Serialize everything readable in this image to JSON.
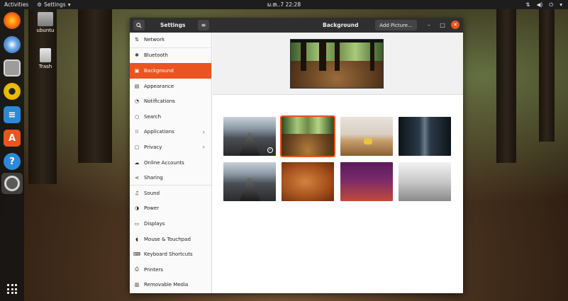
{
  "topbar": {
    "activities": "Activities",
    "app_menu": "Settings",
    "clock": "ພ.ຫ..7  22:28"
  },
  "desktop": {
    "home_label": "ubuntu",
    "trash_label": "Trash"
  },
  "dock": {
    "items": [
      "firefox",
      "thunderbird",
      "files",
      "rhythmbox",
      "writer",
      "software",
      "help",
      "settings"
    ]
  },
  "window": {
    "sidebar_title": "Settings",
    "page_title": "Background",
    "add_picture": "Add Picture...",
    "minimize": "–",
    "maximize": "□",
    "close": "✕"
  },
  "sidebar": {
    "items": [
      {
        "label": "Network",
        "icon": "network-icon"
      },
      {
        "label": "Bluetooth",
        "icon": "bluetooth-icon"
      },
      {
        "label": "Background",
        "icon": "background-icon",
        "selected": true
      },
      {
        "label": "Appearance",
        "icon": "appearance-icon"
      },
      {
        "label": "Notifications",
        "icon": "notifications-icon"
      },
      {
        "label": "Search",
        "icon": "search-icon"
      },
      {
        "label": "Applications",
        "icon": "applications-icon",
        "chevron": true
      },
      {
        "label": "Privacy",
        "icon": "privacy-icon",
        "chevron": true
      },
      {
        "label": "Online Accounts",
        "icon": "online-accounts-icon"
      },
      {
        "label": "Sharing",
        "icon": "sharing-icon"
      },
      {
        "label": "Sound",
        "icon": "sound-icon"
      },
      {
        "label": "Power",
        "icon": "power-icon"
      },
      {
        "label": "Displays",
        "icon": "displays-icon"
      },
      {
        "label": "Mouse & Touchpad",
        "icon": "mouse-icon"
      },
      {
        "label": "Keyboard Shortcuts",
        "icon": "keyboard-icon"
      },
      {
        "label": "Printers",
        "icon": "printer-icon"
      },
      {
        "label": "Removable Media",
        "icon": "removable-media-icon"
      }
    ]
  },
  "colors": {
    "accent": "#e95420",
    "headerbar": "#2f2f2f",
    "topbar": "#1d1d1d"
  },
  "wallpapers": [
    "bridge",
    "forest",
    "cafe",
    "subway",
    "bridge",
    "orange",
    "purple",
    "gray"
  ]
}
